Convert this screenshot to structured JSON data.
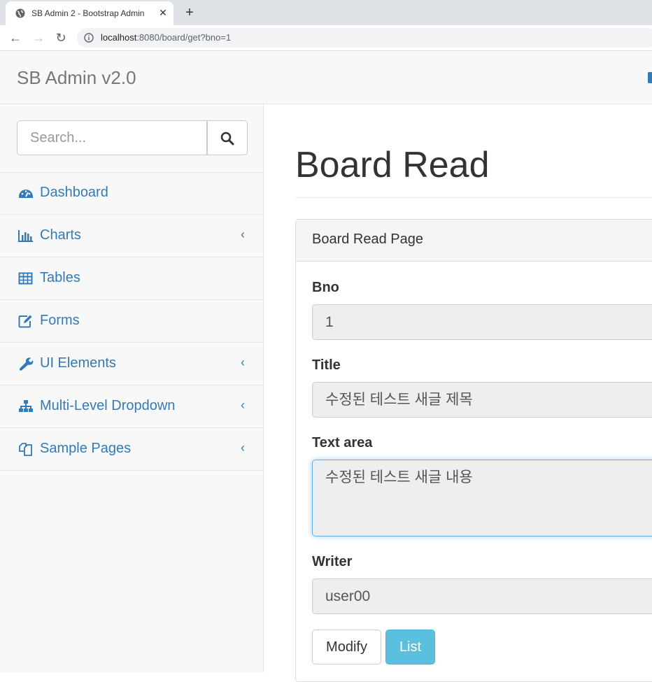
{
  "browser": {
    "tab_title": "SB Admin 2 - Bootstrap Admin",
    "url_host": "localhost",
    "url_rest": ":8080/board/get?bno=1"
  },
  "navbar": {
    "brand": "SB Admin v2.0"
  },
  "sidebar": {
    "search_placeholder": "Search...",
    "items": [
      {
        "label": "Dashboard",
        "icon": "dashboard-icon",
        "has_arrow": false
      },
      {
        "label": "Charts",
        "icon": "bar-chart-icon",
        "has_arrow": true
      },
      {
        "label": "Tables",
        "icon": "table-icon",
        "has_arrow": false
      },
      {
        "label": "Forms",
        "icon": "edit-icon",
        "has_arrow": false
      },
      {
        "label": "UI Elements",
        "icon": "wrench-icon",
        "has_arrow": true
      },
      {
        "label": "Multi-Level Dropdown",
        "icon": "sitemap-icon",
        "has_arrow": true
      },
      {
        "label": "Sample Pages",
        "icon": "files-icon",
        "has_arrow": true
      }
    ]
  },
  "page": {
    "title": "Board Read",
    "panel_heading": "Board Read Page",
    "fields": {
      "bno_label": "Bno",
      "bno_value": "1",
      "title_label": "Title",
      "title_value": "수정된 테스트 새글 제목",
      "content_label": "Text area",
      "content_value": "수정된 테스트 새글 내용",
      "writer_label": "Writer",
      "writer_value": "user00"
    },
    "buttons": {
      "modify": "Modify",
      "list": "List"
    }
  },
  "colors": {
    "link": "#337ab7",
    "info": "#5bc0de",
    "brand_text": "#777777"
  }
}
